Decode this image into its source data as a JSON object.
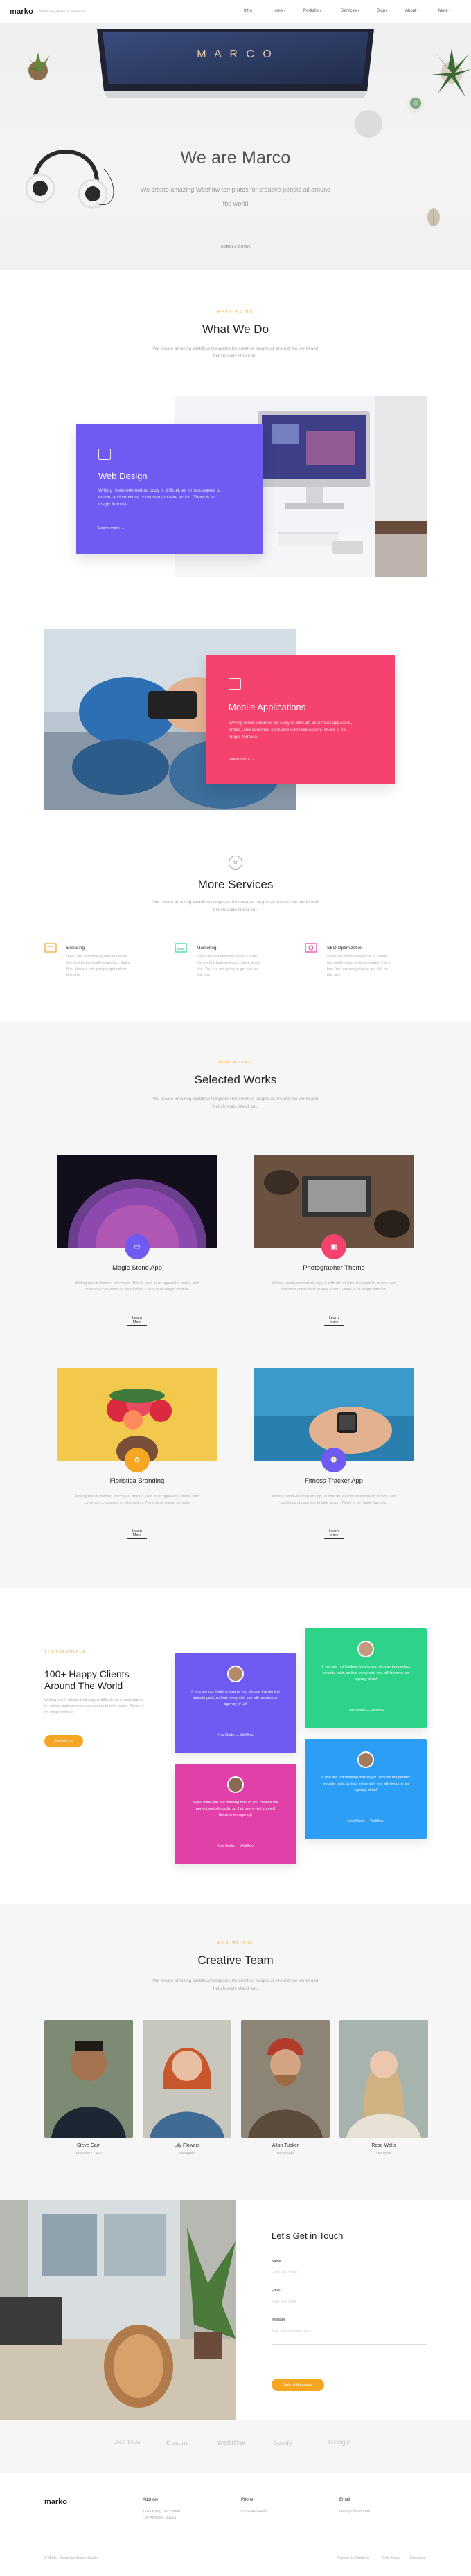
{
  "nav": {
    "logo": "marko",
    "tagline": "Outstanding theme for freelancers",
    "items": [
      {
        "label": "Intro"
      },
      {
        "label": "Home",
        "caret": "▾"
      },
      {
        "label": "Portfolio",
        "caret": "▾"
      },
      {
        "label": "Services",
        "caret": "▾"
      },
      {
        "label": "Blog",
        "caret": "▾"
      },
      {
        "label": "About",
        "caret": "▾"
      },
      {
        "label": "More",
        "caret": "▾"
      }
    ]
  },
  "hero": {
    "monitor_text": "M A R C O",
    "title": "We are Marco",
    "subtitle": "We create amazing Webflow templates for creative people all around the world",
    "cta": "SCROLL DOWN"
  },
  "what_we_do": {
    "label": "WHAT WE DO",
    "title": "What We Do",
    "desc": "We create amazing Webflow templates for creative people all around the world and help brands stand out.",
    "cards": [
      {
        "title": "Web Design",
        "text": "Writing result-oriented ad copy is difficult, as it must appeal to, entice, and convince consumers to take action. There is no magic formula.",
        "link": "Learn more  →",
        "color": "#6f5bf2"
      },
      {
        "title": "Mobile Applications",
        "text": "Writing result-oriented ad copy is difficult, as it must appeal to, entice, and convince consumers to take action. There is no magic formula.",
        "link": "Learn more  →",
        "color": "#f5426e"
      }
    ]
  },
  "more_services": {
    "title": "More Services",
    "desc": "We create amazing Webflow templates for creative people all around the world and help brands stand out.",
    "items": [
      {
        "title": "Branding",
        "text": "If you are not thinking how to create the world's best-selling product, that's fine. You are not going to get rich on this one."
      },
      {
        "title": "Marketing",
        "text": "If you are not thinking how to create the world's best-selling product, that's fine. You are not going to get rich on this one."
      },
      {
        "title": "SEO Optimization",
        "text": "If you are not thinking how to create the world's best-selling product, that's fine. You are not going to get rich on this one."
      }
    ]
  },
  "works": {
    "label": "OUR WORKS",
    "title": "Selected Works",
    "desc": "We create amazing Webflow templates for creative people all around the world and help brands stand out.",
    "items": [
      {
        "title": "Magic Stone App",
        "desc": "Writing result-oriented ad copy is difficult, as it must appeal to, entice, and convince consumers to take action. There is no magic formula.",
        "link": "Learn More"
      },
      {
        "title": "Photographer Theme",
        "desc": "Writing result-oriented ad copy is difficult, as it must appeal to, entice, and convince consumers to take action. There is no magic formula.",
        "link": "Learn More"
      },
      {
        "title": "Floristica Branding",
        "desc": "Writing result-oriented ad copy is difficult, as it must appeal to, entice, and convince consumers to take action. There is no magic formula.",
        "link": "Learn More"
      },
      {
        "title": "Fitness Tracker App",
        "desc": "Writing result-oriented ad copy is difficult, as it must appeal to, entice, and convince consumers to take action. There is no magic formula.",
        "link": "Learn More"
      }
    ]
  },
  "testimonials": {
    "label": "TESTIMONIALS",
    "title": "100+ Happy Clients Around The World",
    "desc": "Writing result-oriented ad copy is difficult, as it must appeal to, entice, and convince consumers to take action. There is no magic formula.",
    "button": "Contact Us",
    "cards": [
      {
        "quote": "If you are not thinking how to you choose the perfect website path, so that every visit you will become an agency of us!",
        "name": "Lisa Marks — Webflow",
        "color": "#6f5bf2"
      },
      {
        "quote": "If you are not thinking how to you choose the perfect website path, so that every visit you will become an agency of us!",
        "name": "Leah Marks — Webflow",
        "color": "#2ed38a"
      },
      {
        "quote": "If you think you are thinking how to you choose the perfect website path, so that every visit you will become an agency!",
        "name": "Lisa Marks — Webflow",
        "color": "#e040a8"
      },
      {
        "quote": "If you are not thinking how to you choose the perfect website path, so that every visit you will become an agency of us!",
        "name": "Lisa Marks — Webflow",
        "color": "#2d9ef5"
      }
    ]
  },
  "team": {
    "label": "WHO WE ARE",
    "title": "Creative Team",
    "desc": "We create amazing Webflow templates for creative people all around the world and help brands stand out.",
    "members": [
      {
        "name": "Steve Cain",
        "role": "Founder / CEO"
      },
      {
        "name": "Lily Flowers",
        "role": "Designer"
      },
      {
        "name": "Allan Tucker",
        "role": "Developer"
      },
      {
        "name": "Rose Wells",
        "role": "Designer"
      }
    ]
  },
  "contact": {
    "title": "Let's Get in Touch",
    "fields": [
      {
        "label": "Name",
        "placeholder": "Enter your name"
      },
      {
        "label": "Email",
        "placeholder": "Enter your email"
      },
      {
        "label": "Message",
        "placeholder": "Type your message here..."
      }
    ],
    "button": "Submit Message"
  },
  "clients": [
    "LOGO IPSUM",
    "Ɛ usona",
    "webflow",
    "Spotify",
    "Google"
  ],
  "footer": {
    "logo": "marko",
    "columns": [
      {
        "title": "Address",
        "text": "1245 Rang Duc Street\nLos Angeles, 90213"
      },
      {
        "title": "Phone",
        "text": "(265) 448 4493"
      },
      {
        "title": "Email",
        "text": "hello@marco.com"
      }
    ],
    "copyright": "© Marko. Design by Illusion Studio",
    "links": [
      "Powered by Webflow",
      "Style Guide",
      "Licensing"
    ]
  }
}
